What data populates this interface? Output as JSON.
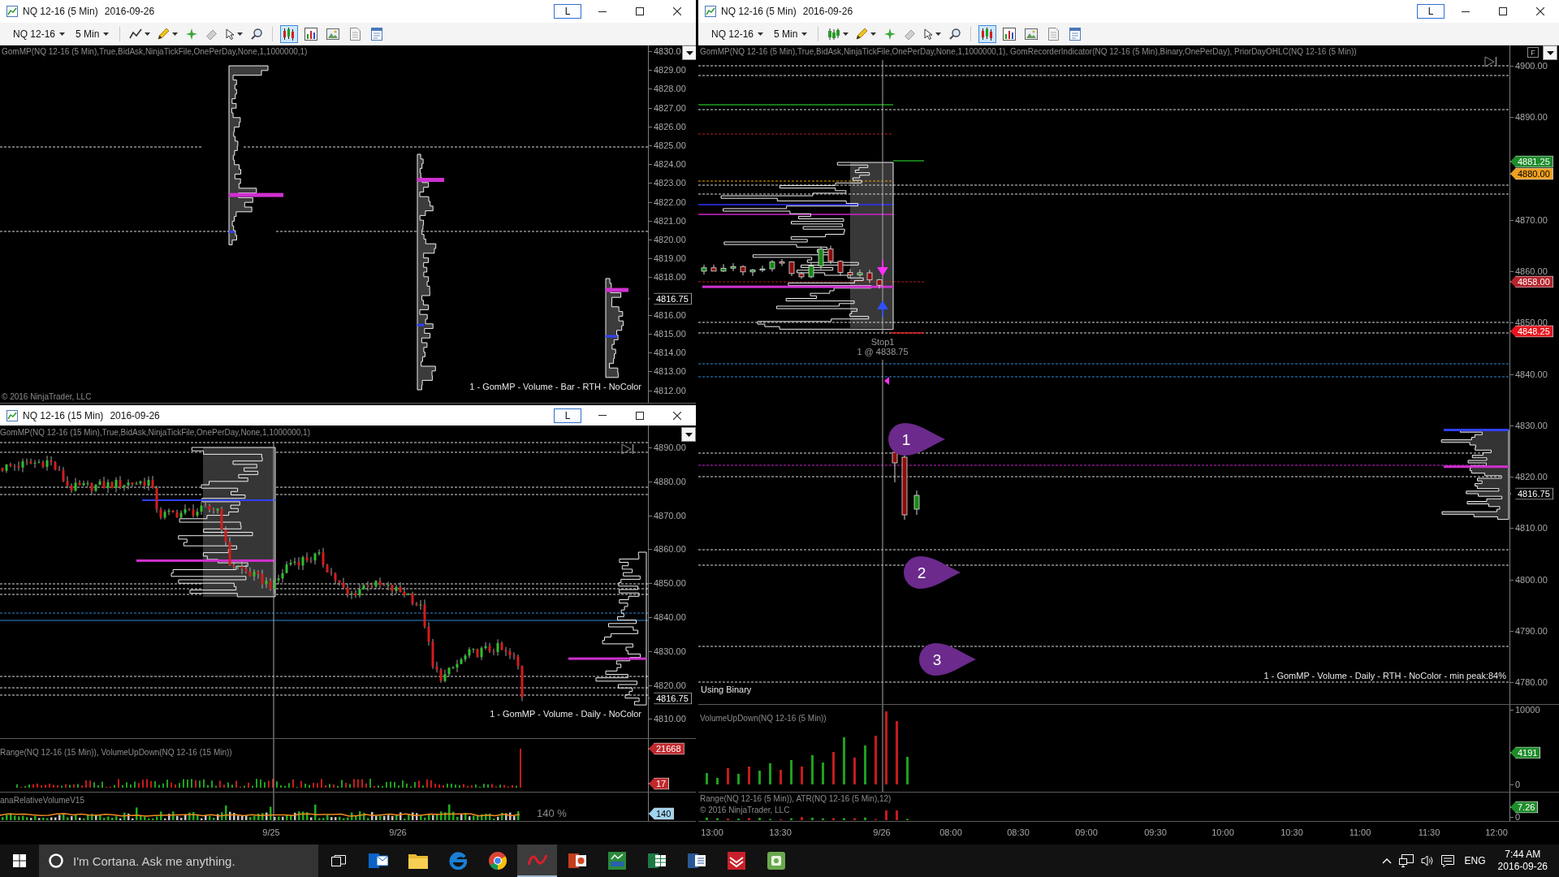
{
  "top_left_window": {
    "title": "NQ 12-16 (5 Min)",
    "date": "2016-09-26",
    "link_button": "L",
    "toolbar": {
      "instrument": "NQ 12-16",
      "interval": "5 Min",
      "toggles": [
        {
          "on": true
        },
        {
          "on": false
        },
        {
          "on": false
        },
        {
          "on": false
        },
        {
          "on": false
        }
      ]
    },
    "indicator_label": "GomMP(NQ 12-16 (5 Min),True,BidAsk,NinjaTickFile,OnePerDay,None,1,1000000,1)",
    "price_axis": [
      "4830.0",
      "4829.00",
      "4828.00",
      "4827.00",
      "4826.00",
      "4825.00",
      "4824.00",
      "4823.00",
      "4822.00",
      "4821.00",
      "4820.00",
      "4819.00",
      "4818.00",
      "4816.00",
      "4815.00",
      "4814.00",
      "4813.00",
      "4812.00"
    ],
    "price_markers": [
      {
        "text": "4816.75",
        "color": "#000000"
      }
    ],
    "profile_label": "1 - GomMP - Volume - Bar - RTH - NoColor",
    "copyright": "© 2016 NinjaTrader, LLC"
  },
  "bottom_left_window": {
    "title": "NQ 12-16 (15 Min)",
    "date": "2016-09-26",
    "link_button": "L",
    "indicator_label": "GomMP(NQ 12-16 (15 Min),True,BidAsk,NinjaTickFile,OnePerDay,None,1,1000000,1)",
    "price_axis": [
      "4890.00",
      "4880.00",
      "4870.00",
      "4860.00",
      "4850.00",
      "4840.00",
      "4830.00",
      "4820.00",
      "4810.00"
    ],
    "price_markers": [
      {
        "text": "4816.75",
        "color": "#000000"
      }
    ],
    "profile_label": "1 - GomMP - Volume - Daily - NoColor",
    "volume_panel": {
      "label": "Range(NQ 12-16 (15 Min)), VolumeUpDown(NQ 12-16 (15 Min))",
      "markers": [
        {
          "text": "21668",
          "color": "#c0282d"
        },
        {
          "text": "17",
          "color": "#c0282d"
        }
      ]
    },
    "relative_volume_panel": {
      "label": "anaRelativeVolumeV15",
      "reading": "140 %",
      "markers": [
        {
          "text": "140",
          "color": "#9fd3ee"
        }
      ]
    },
    "time_axis": [
      "9/25",
      "9/26"
    ]
  },
  "right_window": {
    "title": "NQ 12-16 (5 Min)",
    "date": "2016-09-26",
    "link_button": "L",
    "toolbar": {
      "instrument": "NQ 12-16",
      "interval": "5 Min",
      "toggles": [
        {
          "on": true
        },
        {
          "on": false
        },
        {
          "on": false
        },
        {
          "on": false
        },
        {
          "on": false
        }
      ]
    },
    "indicator_label": "GomMP(NQ 12-16 (5 Min),True,BidAsk,NinjaTickFile,OnePerDay,None,1,1000000,1), GomRecorderIndicator(NQ 12-16 (5 Min),Binary,OnePerDay), PriorDayOHLC(NQ 12-16 (5 Min))",
    "axis_button": "F",
    "price_axis": [
      "4900.00",
      "4890.00",
      "4870.00",
      "4860.00",
      "4850.00",
      "4840.00",
      "4830.00",
      "4820.00",
      "4810.00",
      "4800.00",
      "4790.00",
      "4780.00"
    ],
    "price_markers": [
      {
        "text": "4881.25",
        "color": "#1e8c2a"
      },
      {
        "text": "4880.00",
        "color": "#f0a01e"
      },
      {
        "text": "4858.00",
        "color": "#b4232d"
      },
      {
        "text": "4848.25",
        "color": "#e6141e"
      },
      {
        "text": "4816.75",
        "color": "#000000"
      }
    ],
    "orders": [
      {
        "name": "Stop1",
        "fill": "1 @ 4838.75"
      }
    ],
    "callouts": [
      "1",
      "2",
      "3"
    ],
    "status_text": "Using Binary",
    "profile_label": "1 - GomMP - Volume - Daily - RTH - NoColor - min peak:84%",
    "volume_panel": {
      "label": "VolumeUpDown(NQ 12-16 (5 Min))",
      "axis": [
        "10000",
        "0"
      ],
      "markers": [
        {
          "text": "4191",
          "color": "#1e8c2a"
        }
      ]
    },
    "range_panel": {
      "label": "Range(NQ 12-16 (5 Min)), ATR(NQ 12-16 (5 Min),12)",
      "copyright": "© 2016 NinjaTrader, LLC",
      "axis": [
        "0"
      ],
      "markers": [
        {
          "text": "7.26",
          "color": "#1e8c2a"
        }
      ]
    },
    "time_axis": [
      "13:00",
      "13:30",
      "9/26",
      "08:00",
      "08:30",
      "09:00",
      "09:30",
      "10:00",
      "10:30",
      "11:00",
      "11:30",
      "12:00"
    ]
  },
  "taskbar": {
    "search": {
      "placeholder": "I'm Cortana. Ask me anything."
    },
    "apps": [
      {
        "selected": false
      },
      {
        "selected": false
      },
      {
        "selected": false
      },
      {
        "selected": false
      },
      {
        "selected": true
      },
      {
        "selected": false
      },
      {
        "selected": false
      },
      {
        "selected": false
      },
      {
        "selected": false
      },
      {
        "selected": false
      },
      {
        "selected": false
      }
    ],
    "language": "ENG",
    "time": "7:44 AM",
    "date": "2016-09-26"
  }
}
